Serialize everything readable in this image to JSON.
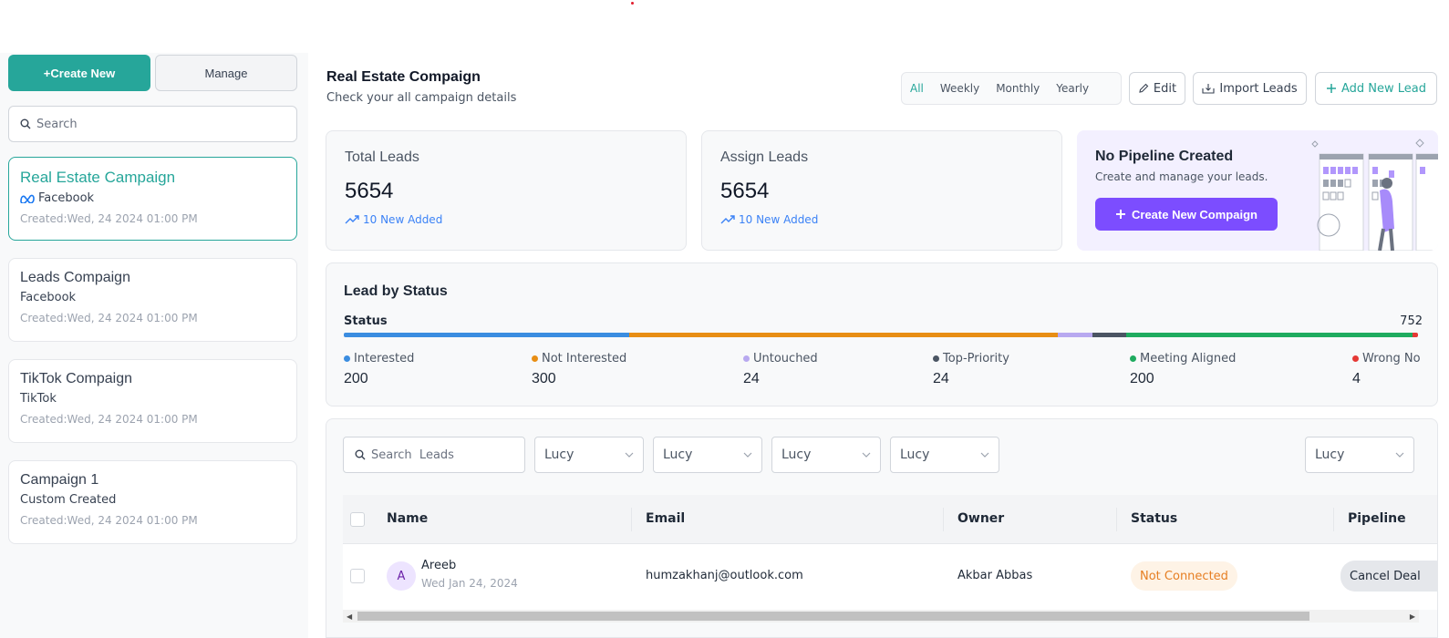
{
  "sidebar": {
    "create_label": "+Create New",
    "manage_label": "Manage",
    "search_placeholder": "Search",
    "campaigns": [
      {
        "title": "Real Estate Campaign",
        "source": "Facebook",
        "created": "Created:Wed, 24 2024 01:00 PM",
        "active": true
      },
      {
        "title": "Leads Compaign",
        "source": "Facebook",
        "created": "Created:Wed, 24 2024 01:00 PM"
      },
      {
        "title": "TikTok Compaign",
        "source": "TikTok",
        "created": "Created:Wed, 24 2024 01:00 PM"
      },
      {
        "title": "Campaign 1",
        "source": "Custom Created",
        "created": "Created:Wed, 24 2024 01:00 PM"
      }
    ]
  },
  "header": {
    "title": "Real Estate Compaign",
    "subtitle": "Check your all campaign details",
    "filters": [
      "All",
      "Weekly",
      "Monthly",
      "Yearly"
    ],
    "active_filter": "All",
    "edit_label": "Edit",
    "import_label": "Import Leads",
    "add_label": "Add New Lead"
  },
  "stats": [
    {
      "label": "Total Leads",
      "value": "5654",
      "new": "10 New Added"
    },
    {
      "label": "Assign Leads",
      "value": "5654",
      "new": "10 New Added"
    }
  ],
  "pipeline": {
    "title": "No Pipeline Created",
    "subtitle": "Create and manage your leads.",
    "button": "Create New Compaign"
  },
  "status": {
    "heading": "Lead by Status",
    "label": "Status",
    "total": "752",
    "items": [
      {
        "name": "Interested",
        "value": "200",
        "color": "#3b8de0"
      },
      {
        "name": "Not Interested",
        "value": "300",
        "color": "#e88e14"
      },
      {
        "name": "Untouched",
        "value": "24",
        "color": "#b8a9f0"
      },
      {
        "name": "Top-Priority",
        "value": "24",
        "color": "#4b5563"
      },
      {
        "name": "Meeting Aligned",
        "value": "200",
        "color": "#1fab5f"
      },
      {
        "name": "Wrong No",
        "value": "4",
        "color": "#e53935"
      }
    ]
  },
  "leads": {
    "search_placeholder": "Search  Leads",
    "filters": [
      "Lucy",
      "Lucy",
      "Lucy",
      "Lucy",
      "Lucy"
    ],
    "columns": [
      "Name",
      "Email",
      "Owner",
      "Status",
      "Pipeline"
    ],
    "rows": [
      {
        "initial": "A",
        "name": "Areeb",
        "date": "Wed Jan 24, 2024",
        "email": "humzakhanj@outlook.com",
        "owner": "Akbar Abbas",
        "status": "Not Connected",
        "pipeline": "Cancel Deal"
      }
    ]
  }
}
